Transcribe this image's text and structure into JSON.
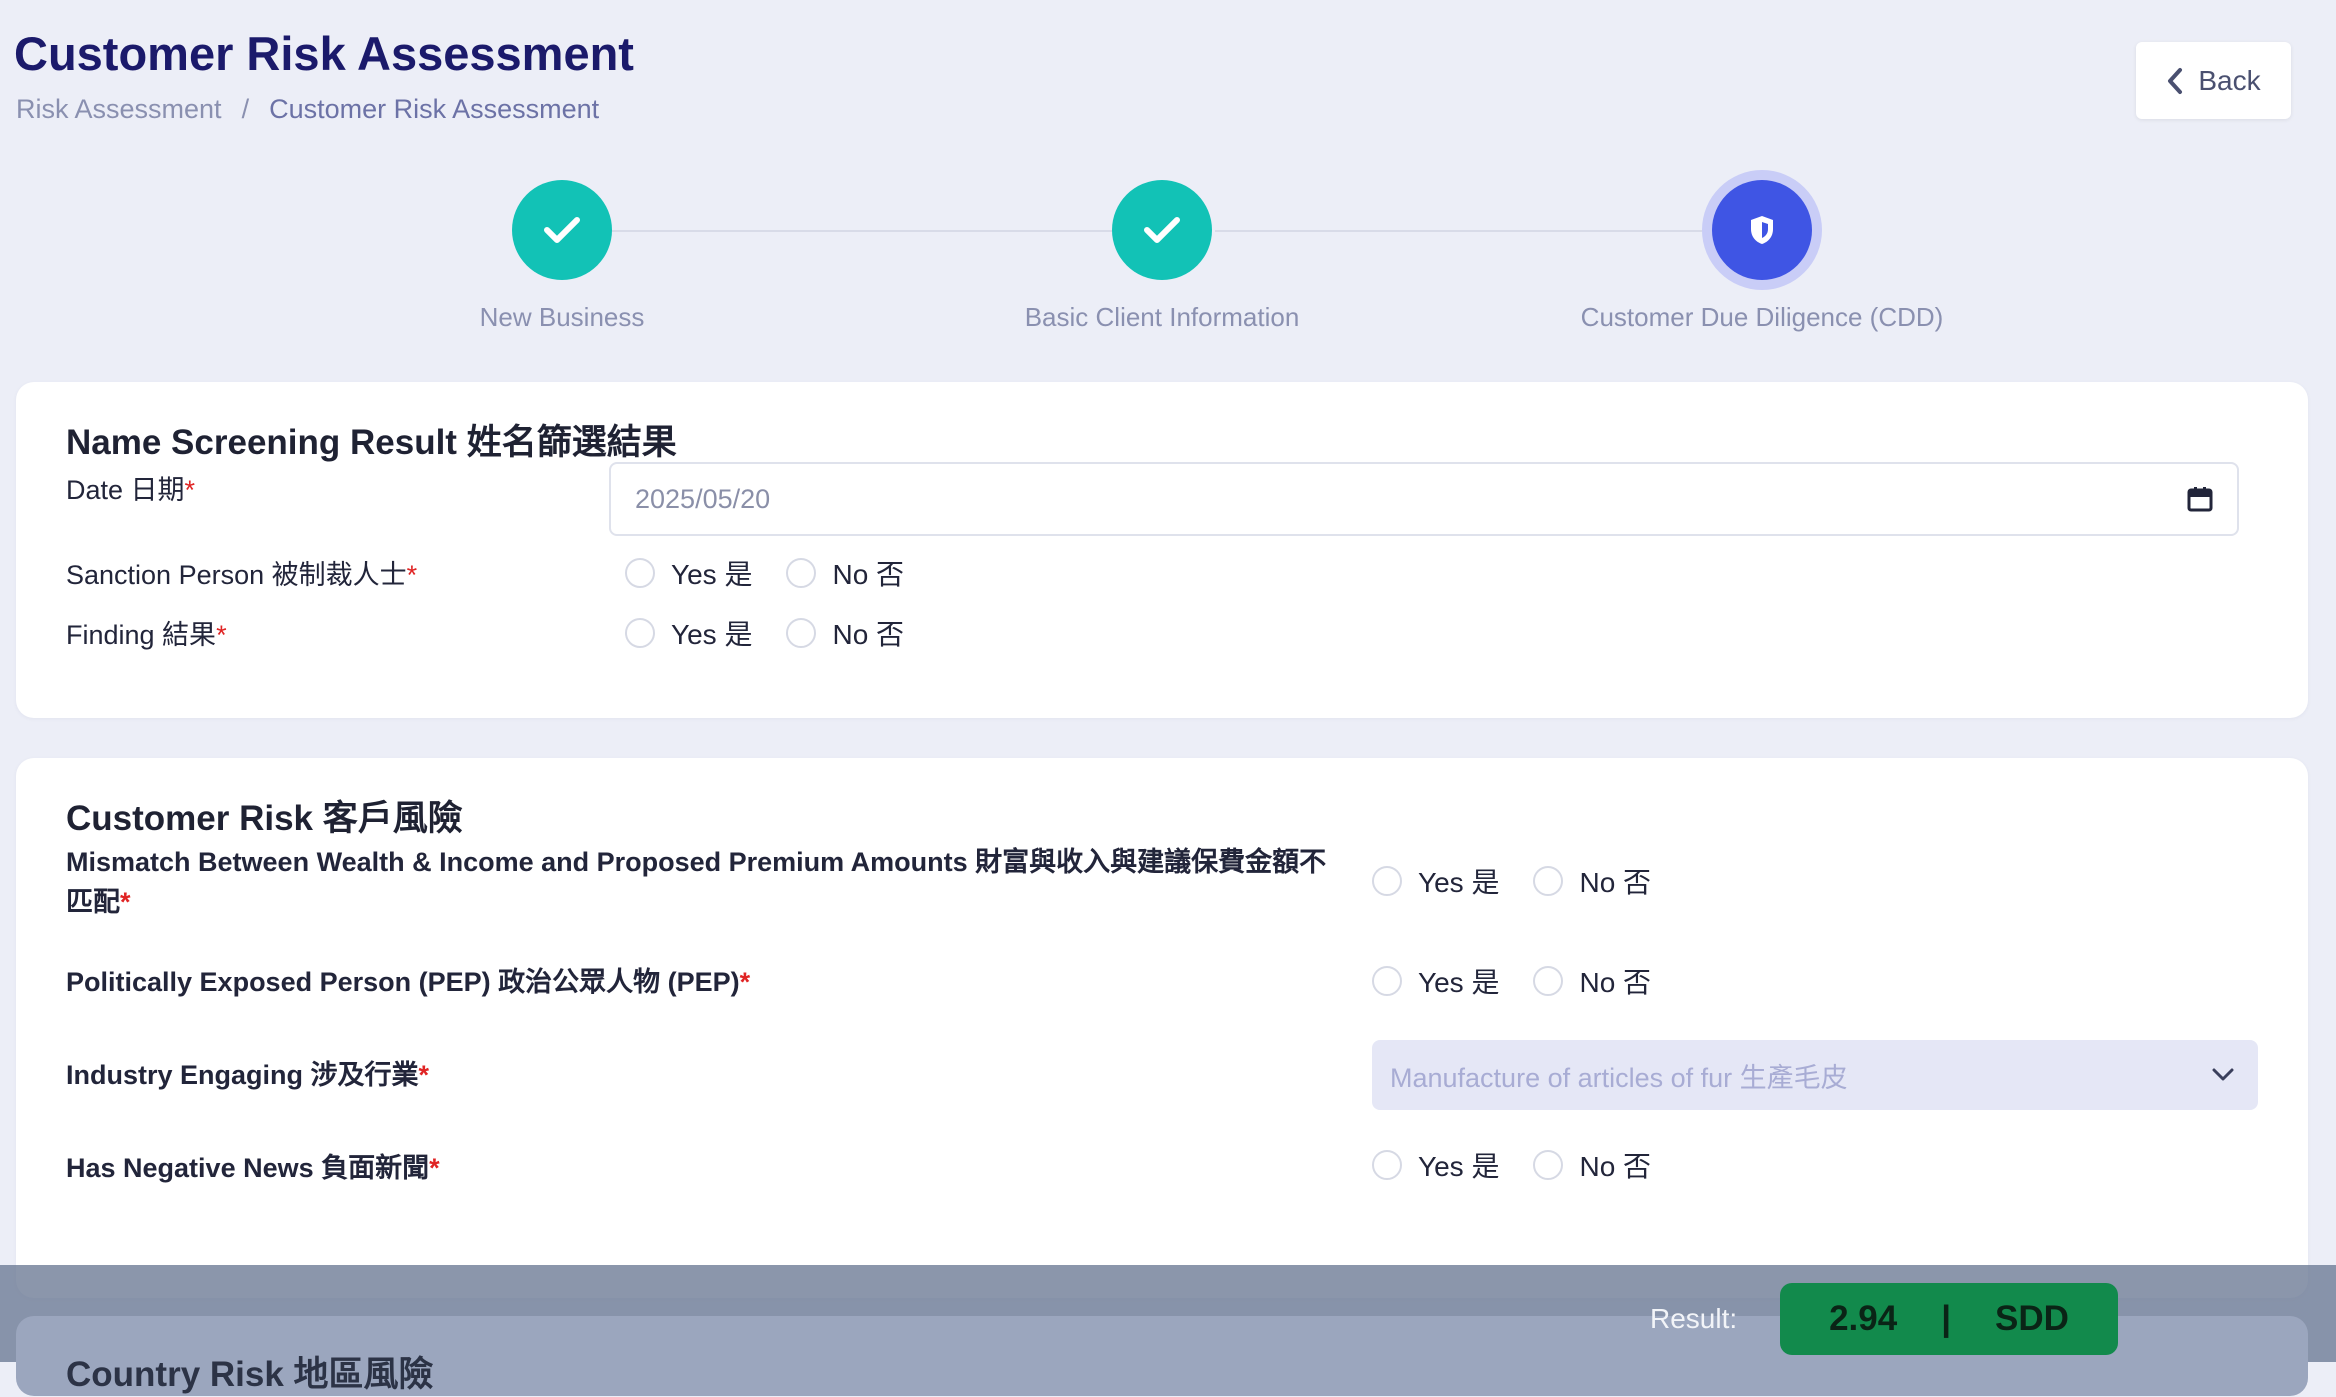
{
  "header": {
    "title": "Customer Risk Assessment",
    "breadcrumb": [
      "Risk Assessment",
      "Customer Risk Assessment"
    ],
    "breadcrumb_sep": "/",
    "back_label": "Back"
  },
  "stepper": {
    "steps": [
      {
        "label": "New Business",
        "status": "done"
      },
      {
        "label": "Basic Client Information",
        "status": "done"
      },
      {
        "label": "Customer Due Diligence (CDD)",
        "status": "active"
      }
    ]
  },
  "name_screening": {
    "title": "Name Screening Result 姓名篩選結果",
    "date_label": "Date 日期",
    "date_value": "2025/05/20",
    "sanction_label": "Sanction Person 被制裁人士",
    "finding_label": "Finding 結果",
    "yes_label": "Yes 是",
    "no_label": "No 否",
    "required_mark": "*"
  },
  "customer_risk": {
    "title": "Customer Risk 客戶風險",
    "mismatch_label": "Mismatch Between Wealth & Income and Proposed Premium Amounts 財富與收入與建議保費金額不匹配",
    "pep_label": "Politically Exposed Person (PEP) 政治公眾人物 (PEP)",
    "industry_label": "Industry Engaging 涉及行業",
    "industry_value": "Manufacture of articles of fur 生產毛皮",
    "negative_news_label": "Has Negative News 負面新聞",
    "yes_label": "Yes 是",
    "no_label": "No 否",
    "required_mark": "*"
  },
  "next_section": {
    "title": "Country Risk 地區風險"
  },
  "result": {
    "label": "Result:",
    "score": "2.94",
    "divider": "|",
    "level": "SDD"
  },
  "colors": {
    "done": "#12c2b6",
    "active": "#3f55e4",
    "result_badge": "#128a4c",
    "title": "#1b1a6b"
  },
  "icons": {
    "back": "chevron-left-icon",
    "done": "check-icon",
    "active": "shield-icon",
    "date": "calendar-icon",
    "select": "chevron-down-icon"
  }
}
